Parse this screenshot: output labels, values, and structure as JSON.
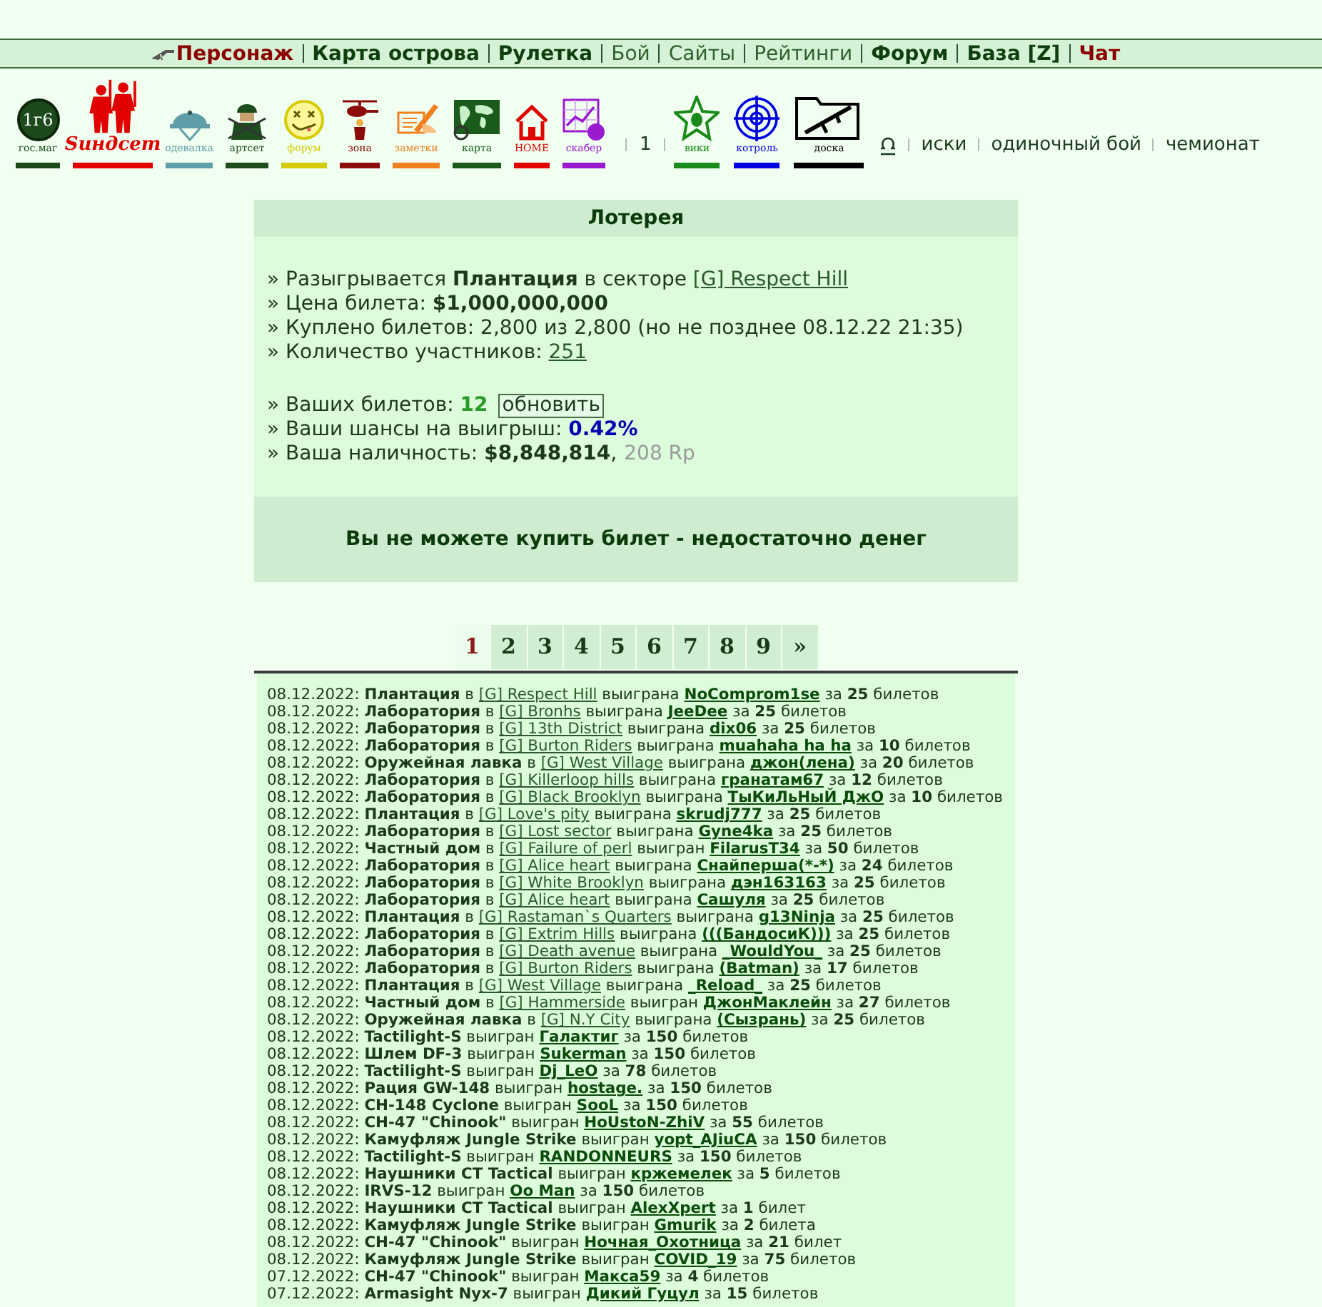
{
  "nav": {
    "items": [
      {
        "label": "Персонаж",
        "bold": true,
        "color": "#8b0000"
      },
      {
        "label": "Карта острова",
        "bold": true,
        "color": "#0f3f0f"
      },
      {
        "label": "Рулетка",
        "bold": true,
        "color": "#0f3f0f"
      },
      {
        "label": "Бой",
        "bold": false,
        "color": "#2f5f2f"
      },
      {
        "label": "Сайты",
        "bold": false,
        "color": "#2f5f2f"
      },
      {
        "label": "Рейтинги",
        "bold": false,
        "color": "#2f5f2f"
      },
      {
        "label": "Форум",
        "bold": true,
        "color": "#0f3f0f"
      },
      {
        "label": "База [Z]",
        "bold": true,
        "color": "#0f3f0f"
      },
      {
        "label": "Чат",
        "bold": true,
        "color": "#8b0000"
      }
    ]
  },
  "toolbar": {
    "icons": [
      {
        "kind": "coin",
        "badge": "1г6",
        "caption": "гос.маг",
        "color": "#1a4a1a"
      },
      {
        "kind": "soldiers",
        "caption": "Sиндсет",
        "color": "#e00000"
      },
      {
        "kind": "helmet",
        "caption": "одевалка",
        "color": "#5f9ea8"
      },
      {
        "kind": "soldier",
        "caption": "артсет",
        "color": "#1d4d1d"
      },
      {
        "kind": "smiley",
        "caption": "форум",
        "color": "#d4cc00"
      },
      {
        "kind": "helicopter",
        "caption": "зона",
        "color": "#8b0a0a"
      },
      {
        "kind": "notes",
        "caption": "заметки",
        "color": "#f08020"
      },
      {
        "kind": "map",
        "caption": "карта",
        "color": "#1a5a1a"
      },
      {
        "kind": "house",
        "caption": "HOME",
        "color": "#e00000"
      },
      {
        "kind": "chart",
        "caption": "скабер",
        "color": "#9a1ad0"
      }
    ],
    "page": "1",
    "icons2": [
      {
        "kind": "star",
        "caption": "вики",
        "color": "#1a8a1a"
      },
      {
        "kind": "target",
        "caption": "котроль",
        "color": "#0000e0"
      },
      {
        "kind": "folder",
        "caption": "доска",
        "color": "#000000"
      }
    ],
    "links": [
      "иски",
      "одиночный бой",
      "чемионат"
    ]
  },
  "lottery": {
    "title": "Лотерея",
    "groups": [
      [
        {
          "parts": [
            {
              "kind": "text",
              "text": "» Разыгрывается "
            },
            {
              "kind": "strong",
              "text": "Плантация"
            },
            {
              "kind": "text",
              "text": " в секторе "
            },
            {
              "kind": "link",
              "text": "[G] Respect Hill"
            }
          ]
        },
        {
          "parts": [
            {
              "kind": "text",
              "text": "» Цена билета: "
            },
            {
              "kind": "strong",
              "text": "$1,000,000,000"
            }
          ]
        },
        {
          "parts": [
            {
              "kind": "text",
              "text": "» Куплено билетов: 2,800 из 2,800 (но не позднее 08.12.22 21:35)"
            }
          ]
        },
        {
          "parts": [
            {
              "kind": "text",
              "text": "» Количество участников: "
            },
            {
              "kind": "link",
              "text": "251"
            }
          ]
        }
      ],
      [
        {
          "parts": [
            {
              "kind": "text",
              "text": "» Ваших билетов: "
            },
            {
              "kind": "count",
              "text": "12"
            },
            {
              "kind": "button",
              "text": "обновить"
            }
          ]
        },
        {
          "parts": [
            {
              "kind": "text",
              "text": "» Ваши шансы на выигрыш: "
            },
            {
              "kind": "percent",
              "text": "0.42%"
            }
          ]
        },
        {
          "parts": [
            {
              "kind": "text",
              "text": "» Ваша наличность: "
            },
            {
              "kind": "strong",
              "text": "$8,848,814"
            },
            {
              "kind": "text",
              "text": ","
            },
            {
              "kind": "muted",
              "text": "208 Rp"
            }
          ]
        }
      ]
    ],
    "notice": "Вы не можете купить билет - недостаточно денег"
  },
  "pages": [
    {
      "label": "1",
      "selected": true
    },
    {
      "label": "2",
      "selected": false
    },
    {
      "label": "3",
      "selected": false
    },
    {
      "label": "4",
      "selected": false
    },
    {
      "label": "5",
      "selected": false
    },
    {
      "label": "6",
      "selected": false
    },
    {
      "label": "7",
      "selected": false
    },
    {
      "label": "8",
      "selected": false
    },
    {
      "label": "9",
      "selected": false
    },
    {
      "label": "»",
      "selected": false
    }
  ],
  "wins": [
    {
      "date": "08.12.2022:",
      "prize": "Плантация",
      "in": "в",
      "sector": "[G] Respect Hill",
      "verb": "выиграна",
      "winner": "NoComprom1se",
      "for": "за",
      "tickets": "25",
      "unit": "билетов"
    },
    {
      "date": "08.12.2022:",
      "prize": "Лаборатория",
      "in": "в",
      "sector": "[G] Bronhs",
      "verb": "выиграна",
      "winner": "JeeDee",
      "for": "за",
      "tickets": "25",
      "unit": "билетов"
    },
    {
      "date": "08.12.2022:",
      "prize": "Лаборатория",
      "in": "в",
      "sector": "[G] 13th District",
      "verb": "выиграна",
      "winner": "dix06",
      "for": "за",
      "tickets": "25",
      "unit": "билетов"
    },
    {
      "date": "08.12.2022:",
      "prize": "Лаборатория",
      "in": "в",
      "sector": "[G] Burton Riders",
      "verb": "выиграна",
      "winner": "muahaha ha ha",
      "for": "за",
      "tickets": "10",
      "unit": "билетов"
    },
    {
      "date": "08.12.2022:",
      "prize": "Оружейная лавка",
      "in": "в",
      "sector": "[G] West Village",
      "verb": "выиграна",
      "winner": "джон(лена)",
      "for": "за",
      "tickets": "20",
      "unit": "билетов"
    },
    {
      "date": "08.12.2022:",
      "prize": "Лаборатория",
      "in": "в",
      "sector": "[G] Killerloop hills",
      "verb": "выиграна",
      "winner": "гранатам67",
      "for": "за",
      "tickets": "12",
      "unit": "билетов"
    },
    {
      "date": "08.12.2022:",
      "prize": "Лаборатория",
      "in": "в",
      "sector": "[G] Black Brooklyn",
      "verb": "выиграна",
      "winner": "ТыКиЛьНыЙ ДжО",
      "for": "за",
      "tickets": "10",
      "unit": "билетов"
    },
    {
      "date": "08.12.2022:",
      "prize": "Плантация",
      "in": "в",
      "sector": "[G] Love's pity",
      "verb": "выиграна",
      "winner": "skrudj777",
      "for": "за",
      "tickets": "25",
      "unit": "билетов"
    },
    {
      "date": "08.12.2022:",
      "prize": "Лаборатория",
      "in": "в",
      "sector": "[G] Lost sector",
      "verb": "выиграна",
      "winner": "Gyne4ka",
      "for": "за",
      "tickets": "25",
      "unit": "билетов"
    },
    {
      "date": "08.12.2022:",
      "prize": "Частный дом",
      "in": "в",
      "sector": "[G] Failure of perl",
      "verb": "выигран",
      "winner": "FilarusT34",
      "for": "за",
      "tickets": "50",
      "unit": "билетов"
    },
    {
      "date": "08.12.2022:",
      "prize": "Лаборатория",
      "in": "в",
      "sector": "[G] Alice heart",
      "verb": "выиграна",
      "winner": "Снайперша(*-*)",
      "for": "за",
      "tickets": "24",
      "unit": "билетов"
    },
    {
      "date": "08.12.2022:",
      "prize": "Лаборатория",
      "in": "в",
      "sector": "[G] White Brooklyn",
      "verb": "выиграна",
      "winner": "дэн163163",
      "for": "за",
      "tickets": "25",
      "unit": "билетов"
    },
    {
      "date": "08.12.2022:",
      "prize": "Лаборатория",
      "in": "в",
      "sector": "[G] Alice heart",
      "verb": "выиграна",
      "winner": "Сашуля",
      "for": "за",
      "tickets": "25",
      "unit": "билетов"
    },
    {
      "date": "08.12.2022:",
      "prize": "Плантация",
      "in": "в",
      "sector": "[G] Rastaman`s Quarters",
      "verb": "выиграна",
      "winner": "g13Ninja",
      "for": "за",
      "tickets": "25",
      "unit": "билетов"
    },
    {
      "date": "08.12.2022:",
      "prize": "Лаборатория",
      "in": "в",
      "sector": "[G] Extrim Hills",
      "verb": "выиграна",
      "winner": "(((БандосиК)))",
      "for": "за",
      "tickets": "25",
      "unit": "билетов"
    },
    {
      "date": "08.12.2022:",
      "prize": "Лаборатория",
      "in": "в",
      "sector": "[G] Death avenue",
      "verb": "выиграна",
      "winner": "_WouldYou_",
      "for": "за",
      "tickets": "25",
      "unit": "билетов"
    },
    {
      "date": "08.12.2022:",
      "prize": "Лаборатория",
      "in": "в",
      "sector": "[G] Burton Riders",
      "verb": "выиграна",
      "winner": "(Batman)",
      "for": "за",
      "tickets": "17",
      "unit": "билетов"
    },
    {
      "date": "08.12.2022:",
      "prize": "Плантация",
      "in": "в",
      "sector": "[G] West Village",
      "verb": "выиграна",
      "winner": "_Reload_",
      "for": "за",
      "tickets": "25",
      "unit": "билетов"
    },
    {
      "date": "08.12.2022:",
      "prize": "Частный дом",
      "in": "в",
      "sector": "[G] Hammerside",
      "verb": "выигран",
      "winner": "ДжонМаклейн",
      "for": "за",
      "tickets": "27",
      "unit": "билетов"
    },
    {
      "date": "08.12.2022:",
      "prize": "Оружейная лавка",
      "in": "в",
      "sector": "[G] N.Y City",
      "verb": "выиграна",
      "winner": "(Сызрань)",
      "for": "за",
      "tickets": "25",
      "unit": "билетов"
    },
    {
      "date": "08.12.2022:",
      "prize": "Tactilight-S",
      "verb": "выигран",
      "winner": "Галактиг",
      "for": "за",
      "tickets": "150",
      "unit": "билетов"
    },
    {
      "date": "08.12.2022:",
      "prize": "Шлем DF-3",
      "verb": "выигран",
      "winner": "Sukerman",
      "for": "за",
      "tickets": "150",
      "unit": "билетов"
    },
    {
      "date": "08.12.2022:",
      "prize": "Tactilight-S",
      "verb": "выигран",
      "winner": "Dj_LeO",
      "for": "за",
      "tickets": "78",
      "unit": "билетов"
    },
    {
      "date": "08.12.2022:",
      "prize": "Рация GW-148",
      "verb": "выигран",
      "winner": "hostage.",
      "for": "за",
      "tickets": "150",
      "unit": "билетов"
    },
    {
      "date": "08.12.2022:",
      "prize": "CH-148 Cyclone",
      "verb": "выигран",
      "winner": "SooL",
      "for": "за",
      "tickets": "150",
      "unit": "билетов"
    },
    {
      "date": "08.12.2022:",
      "prize": "CH-47 \"Chinook\"",
      "verb": "выигран",
      "winner": "HoUstoN-ZhiV",
      "for": "за",
      "tickets": "55",
      "unit": "билетов"
    },
    {
      "date": "08.12.2022:",
      "prize": "Камуфляж Jungle Strike",
      "verb": "выигран",
      "winner": "yopt_AJiuCA",
      "for": "за",
      "tickets": "150",
      "unit": "билетов"
    },
    {
      "date": "08.12.2022:",
      "prize": "Tactilight-S",
      "verb": "выигран",
      "winner": "RANDONNEURS",
      "for": "за",
      "tickets": "150",
      "unit": "билетов"
    },
    {
      "date": "08.12.2022:",
      "prize": "Наушники CT Tactical",
      "verb": "выигран",
      "winner": "кржемелек",
      "for": "за",
      "tickets": "5",
      "unit": "билетов"
    },
    {
      "date": "08.12.2022:",
      "prize": "IRVS-12",
      "verb": "выигран",
      "winner": "Oo Man",
      "for": "за",
      "tickets": "150",
      "unit": "билетов"
    },
    {
      "date": "08.12.2022:",
      "prize": "Наушники CT Tactical",
      "verb": "выигран",
      "winner": "AlexXpert",
      "for": "за",
      "tickets": "1",
      "unit": "билет"
    },
    {
      "date": "08.12.2022:",
      "prize": "Камуфляж Jungle Strike",
      "verb": "выигран",
      "winner": "Gmurik",
      "for": "за",
      "tickets": "2",
      "unit": "билета"
    },
    {
      "date": "08.12.2022:",
      "prize": "CH-47 \"Chinook\"",
      "verb": "выигран",
      "winner": "Ночная_Охотница",
      "for": "за",
      "tickets": "21",
      "unit": "билет"
    },
    {
      "date": "08.12.2022:",
      "prize": "Камуфляж Jungle Strike",
      "verb": "выигран",
      "winner": "COVID_19",
      "for": "за",
      "tickets": "75",
      "unit": "билетов"
    },
    {
      "date": "07.12.2022:",
      "prize": "CH-47 \"Chinook\"",
      "verb": "выигран",
      "winner": "Макса59",
      "for": "за",
      "tickets": "4",
      "unit": "билетов"
    },
    {
      "date": "07.12.2022:",
      "prize": "Armasight Nyx-7",
      "verb": "выигран",
      "winner": "Дикий Гуцул",
      "for": "за",
      "tickets": "15",
      "unit": "билетов"
    }
  ]
}
